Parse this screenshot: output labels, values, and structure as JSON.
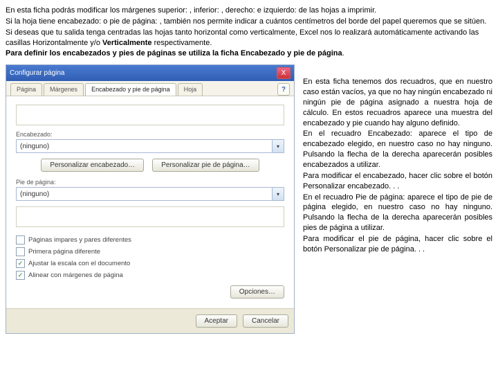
{
  "intro": {
    "p1": "En esta ficha podrás modificar los márgenes superior: , inferior: , derecho: e izquierdo: de las hojas a imprimir.",
    "p2": "Si la hoja tiene encabezado: o pie de página: , también nos permite indicar a cuántos centímetros del borde del papel queremos que se sitúen.",
    "p3a": "Si deseas que tu salida tenga centradas las hojas tanto horizontal como verticalmente, Excel nos lo realizará automáticamente activando las casillas Horizontalmente y/o ",
    "p3b_bold": "Verticalmente",
    "p3c": " respectivamente.",
    "p4_bold": "Para definir los encabezados y pies de páginas se utiliza la ficha Encabezado y pie de página",
    "p4_end": "."
  },
  "dialog": {
    "title": "Configurar página",
    "close_x": "X",
    "help": "?",
    "tabs": {
      "t1": "Página",
      "t2": "Márgenes",
      "t3": "Encabezado y pie de página",
      "t4": "Hoja"
    },
    "encabezado_label": "Encabezado:",
    "pie_label": "Pie de página:",
    "combo_value": "(ninguno)",
    "btn_pers_enc": "Personalizar encabezado…",
    "btn_pers_pie": "Personalizar pie de página…",
    "chk1": "Páginas impares y pares diferentes",
    "chk2": "Primera página diferente",
    "chk3": "Ajustar la escala con el documento",
    "chk4": "Alinear con márgenes de página",
    "options": "Opciones…",
    "ok": "Aceptar",
    "cancel": "Cancelar"
  },
  "right": {
    "r1": "En esta ficha tenemos dos recuadros, que en nuestro caso están vacíos, ya que no hay ningún encabezado ni ningún pie de página asignado a nuestra hoja de cálculo. En estos recuadros aparece una muestra del encabezado y pie cuando hay alguno definido.",
    "r2": "En el recuadro Encabezado: aparece el tipo de encabezado elegido, en nuestro caso no hay ninguno. Pulsando la flecha de la derecha aparecerán posibles encabezados a utilizar.",
    "r3": "Para modificar el encabezado, hacer clic sobre el botón Personalizar encabezado. . .",
    "r4": "En el recuadro Pie de página: aparece el tipo de pie de página elegido, en nuestro caso no hay ninguno. Pulsando la flecha de la derecha aparecerán posibles pies de página a utilizar.",
    "r5": "Para modificar el pie de página, hacer clic sobre el botón Personalizar pie de página. . ."
  }
}
